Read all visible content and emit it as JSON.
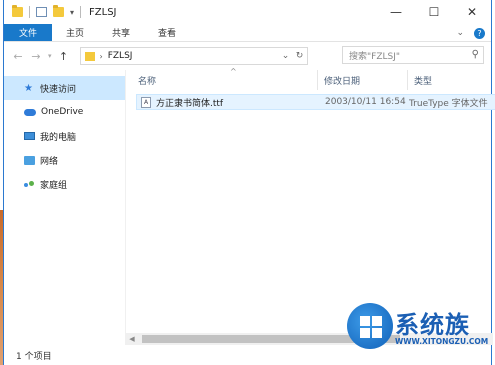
{
  "window": {
    "title": "FZLSJ"
  },
  "controls": {
    "minimize": "—",
    "maximize": "☐",
    "close": "✕"
  },
  "ribbon": {
    "tabs": [
      "文件",
      "主页",
      "共享",
      "查看"
    ],
    "expand": "⌄",
    "help": "?"
  },
  "address": {
    "path": "FZLSJ",
    "back": "←",
    "forward": "→",
    "up": "↑",
    "search_placeholder": "搜索\"FZLSJ\""
  },
  "nav": {
    "items": [
      {
        "label": "快速访问",
        "icon": "star-icon",
        "selected": true
      },
      {
        "label": "OneDrive",
        "icon": "cloud-icon"
      },
      {
        "label": "我的电脑",
        "icon": "computer-icon"
      },
      {
        "label": "网络",
        "icon": "network-icon"
      },
      {
        "label": "家庭组",
        "icon": "homegroup-icon"
      }
    ]
  },
  "columns": {
    "name": "名称",
    "date": "修改日期",
    "type": "类型"
  },
  "files": [
    {
      "name": "方正隶书简体.ttf",
      "date": "2003/10/11 16:54",
      "type": "TrueType 字体文件"
    }
  ],
  "status": {
    "count": "1 个项目"
  },
  "watermark": {
    "title": "系统族",
    "url": "WWW.XITONGZU.COM"
  },
  "colors": {
    "accent": "#1979ca",
    "selection": "#cce8ff"
  }
}
